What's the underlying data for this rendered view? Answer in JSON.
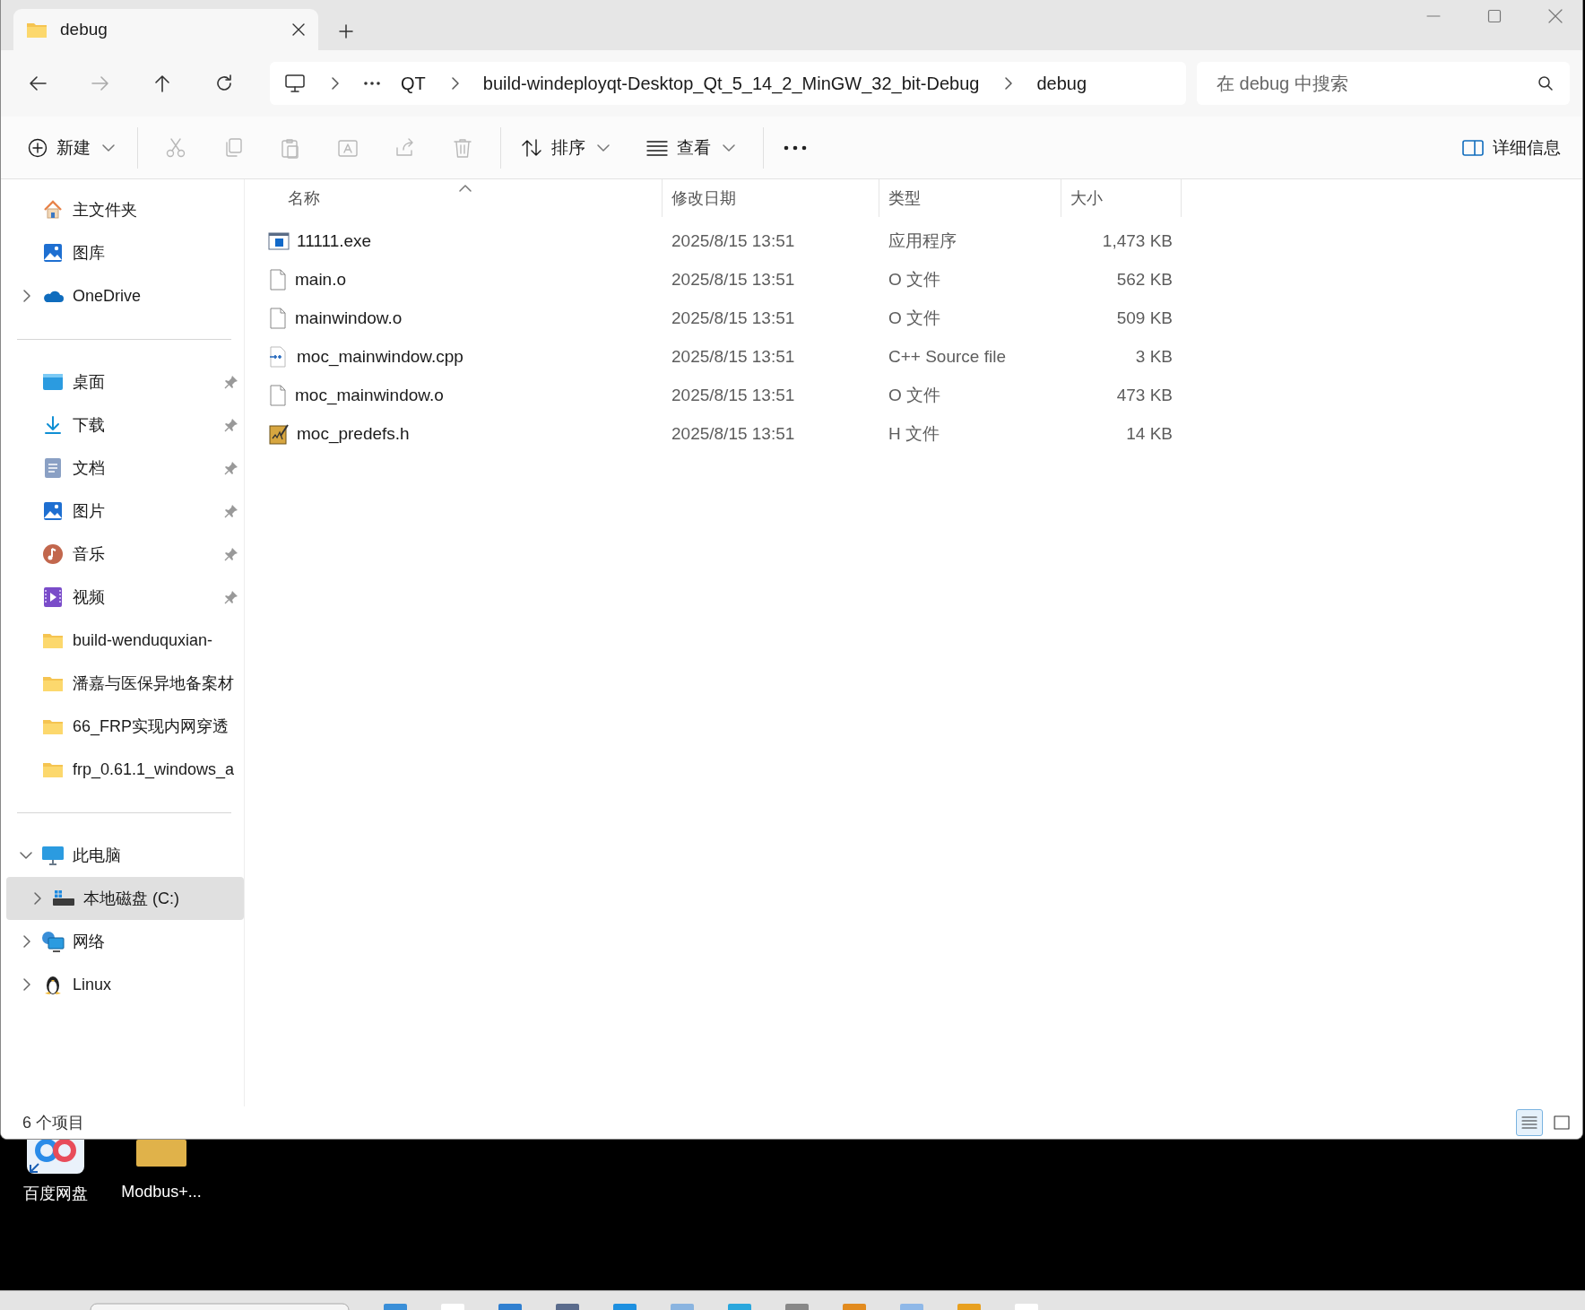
{
  "tab": {
    "title": "debug",
    "selected": true
  },
  "address": {
    "segments": [
      "QT",
      "build-windeployqt-Desktop_Qt_5_14_2_MinGW_32_bit-Debug",
      "debug"
    ]
  },
  "search": {
    "placeholder": "在 debug 中搜索"
  },
  "toolbar": {
    "new_label": "新建",
    "sort_label": "排序",
    "view_label": "查看",
    "details_label": "详细信息",
    "actions": [
      {
        "kind": "cut",
        "disabled": true
      },
      {
        "kind": "copy",
        "disabled": true
      },
      {
        "kind": "paste",
        "disabled": true
      },
      {
        "kind": "rename",
        "disabled": true
      },
      {
        "kind": "share",
        "disabled": true
      },
      {
        "kind": "delete",
        "disabled": true
      }
    ]
  },
  "sidebar": {
    "sections": [
      [
        {
          "label": "主文件夹",
          "kind": "home",
          "selected": false
        },
        {
          "label": "图库",
          "kind": "gallery",
          "selected": false
        },
        {
          "label": "OneDrive",
          "kind": "cloud",
          "selected": false,
          "expanded": false
        }
      ],
      [
        {
          "label": "桌面",
          "kind": "desktop",
          "selected": false,
          "pinned": true
        },
        {
          "label": "下载",
          "kind": "download",
          "selected": false,
          "pinned": true
        },
        {
          "label": "文档",
          "kind": "document",
          "selected": false,
          "pinned": true
        },
        {
          "label": "图片",
          "kind": "picture",
          "selected": false,
          "pinned": true
        },
        {
          "label": "音乐",
          "kind": "music",
          "selected": false,
          "pinned": true
        },
        {
          "label": "视频",
          "kind": "video",
          "selected": false,
          "pinned": true
        },
        {
          "label": "build-wenduquxian-",
          "kind": "folder",
          "selected": false,
          "pinned": false
        },
        {
          "label": "潘嘉与医保异地备案材",
          "kind": "folder",
          "selected": false,
          "pinned": false
        },
        {
          "label": "66_FRP实现内网穿透",
          "kind": "folder",
          "selected": false,
          "pinned": false
        },
        {
          "label": "frp_0.61.1_windows_a",
          "kind": "folder",
          "selected": false,
          "pinned": false
        }
      ],
      [
        {
          "label": "此电脑",
          "kind": "pc",
          "selected": false,
          "expanded": true,
          "children": [
            {
              "label": "本地磁盘 (C:)",
              "kind": "drive",
              "selected": true,
              "expanded": false
            }
          ]
        },
        {
          "label": "网络",
          "kind": "network",
          "selected": false,
          "expanded": false
        },
        {
          "label": "Linux",
          "kind": "linux",
          "selected": false,
          "expanded": false
        }
      ]
    ]
  },
  "files": {
    "columns": [
      {
        "label": "名称",
        "sorted": true
      },
      {
        "label": "修改日期",
        "sorted": false
      },
      {
        "label": "类型",
        "sorted": false
      },
      {
        "label": "大小",
        "sorted": false
      }
    ],
    "rows": [
      {
        "name": "11111.exe",
        "kind": "exe",
        "date": "2025/8/15 13:51",
        "type": "应用程序",
        "size": "1,473 KB"
      },
      {
        "name": "main.o",
        "kind": "file",
        "date": "2025/8/15 13:51",
        "type": "O 文件",
        "size": "562 KB"
      },
      {
        "name": "mainwindow.o",
        "kind": "file",
        "date": "2025/8/15 13:51",
        "type": "O 文件",
        "size": "509 KB"
      },
      {
        "name": "moc_mainwindow.cpp",
        "kind": "cpp",
        "date": "2025/8/15 13:51",
        "type": "C++ Source file",
        "size": "3 KB"
      },
      {
        "name": "moc_mainwindow.o",
        "kind": "file",
        "date": "2025/8/15 13:51",
        "type": "O 文件",
        "size": "473 KB"
      },
      {
        "name": "moc_predefs.h",
        "kind": "header",
        "date": "2025/8/15 13:51",
        "type": "H 文件",
        "size": "14 KB"
      }
    ]
  },
  "status_bar": {
    "count": "6 个项目",
    "views": [
      {
        "kind": "details",
        "selected": true
      },
      {
        "kind": "tiles",
        "selected": false
      }
    ]
  },
  "desktop": {
    "icons": [
      {
        "label": "百度网盘",
        "kind": "app"
      },
      {
        "label": "Modbus+...",
        "kind": "folder"
      }
    ]
  }
}
